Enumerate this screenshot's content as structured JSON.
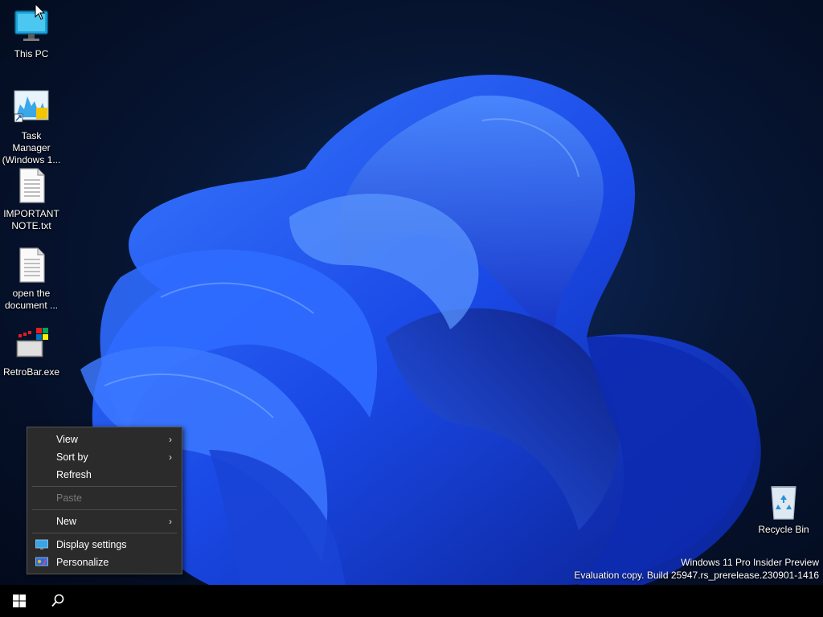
{
  "desktop_icons": [
    {
      "label": "This PC",
      "icon": "monitor-icon"
    },
    {
      "label": "Task Manager (Windows 1...",
      "icon": "task-manager-icon"
    },
    {
      "label": "IMPORTANT NOTE.txt",
      "icon": "text-file-icon"
    },
    {
      "label": "open the document ...",
      "icon": "text-file-icon"
    },
    {
      "label": "RetroBar.exe",
      "icon": "retrobar-icon"
    }
  ],
  "recycle_bin": {
    "label": "Recycle Bin",
    "icon": "recycle-bin-icon"
  },
  "context_menu": {
    "view": "View",
    "sort_by": "Sort by",
    "refresh": "Refresh",
    "paste": "Paste",
    "new": "New",
    "display_settings": "Display settings",
    "personalize": "Personalize"
  },
  "watermark": {
    "line1": "Windows 11 Pro Insider Preview",
    "line2": "Evaluation copy. Build 25947.rs_prerelease.230901-1416"
  },
  "taskbar": {
    "start_icon": "windows-logo-icon",
    "search_icon": "search-icon"
  },
  "colors": {
    "menu_bg": "#2b2b2b",
    "taskbar_bg": "#000000",
    "accent_blue": "#1f4fe0"
  }
}
